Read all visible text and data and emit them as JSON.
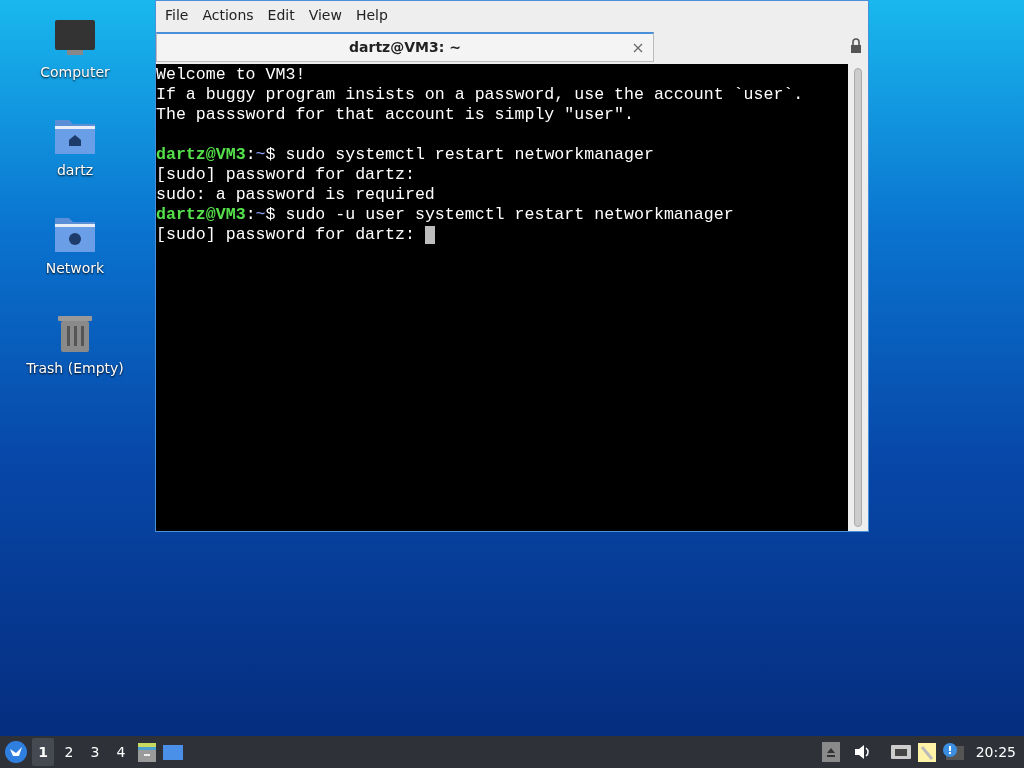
{
  "desktop_icons": [
    {
      "kind": "computer",
      "label": "Computer"
    },
    {
      "kind": "home",
      "label": "dartz"
    },
    {
      "kind": "network",
      "label": "Network"
    },
    {
      "kind": "trash",
      "label": "Trash (Empty)"
    }
  ],
  "window": {
    "menu": [
      "File",
      "Actions",
      "Edit",
      "View",
      "Help"
    ],
    "tabs": [
      {
        "title": "dartz@VM3: ~",
        "selected": true
      }
    ],
    "terminal": [
      {
        "kind": "text",
        "text": "Welcome to VM3!"
      },
      {
        "kind": "text",
        "text": "If a buggy program insists on a password, use the account `user`."
      },
      {
        "kind": "text",
        "text": "The passsword for that account is simply \"user\"."
      },
      {
        "kind": "blank"
      },
      {
        "kind": "prompt",
        "user_host": "dartz@VM3",
        "separator": ":",
        "path": "~",
        "symbol": "$",
        "command": "sudo systemctl restart networkmanager"
      },
      {
        "kind": "text",
        "text": "[sudo] password for dartz:"
      },
      {
        "kind": "text",
        "text": "sudo: a password is required"
      },
      {
        "kind": "prompt",
        "user_host": "dartz@VM3",
        "separator": ":",
        "path": "~",
        "symbol": "$",
        "command": "sudo -u user systemctl restart networkmanager"
      },
      {
        "kind": "text",
        "text": "[sudo] password for dartz:",
        "cursor": true
      }
    ]
  },
  "taskbar": {
    "workspaces": [
      {
        "label": "1",
        "selected": true
      },
      {
        "label": "2",
        "selected": false
      },
      {
        "label": "3",
        "selected": false
      },
      {
        "label": "4",
        "selected": false
      }
    ],
    "clock": "20:25"
  }
}
